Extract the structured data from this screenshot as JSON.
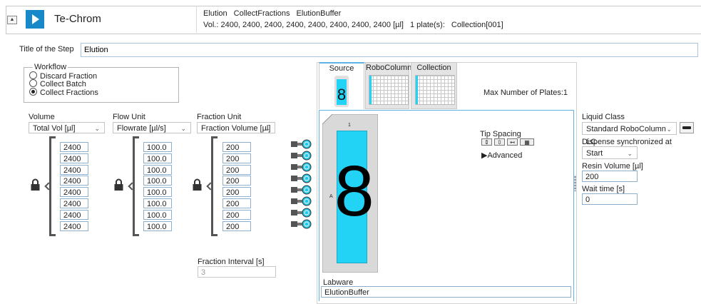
{
  "header": {
    "app_name": "Te-Chrom",
    "line1": [
      "Elution",
      "CollectFractions",
      "ElutionBuffer"
    ],
    "line2_volume": "Vol.: 2400, 2400, 2400, 2400, 2400, 2400, 2400, 2400 [µl]",
    "line2_plates": "1 plate(s):",
    "line2_collection": "Collection[001]",
    "brand_color": "#1789c8"
  },
  "step": {
    "title_label": "Title of the Step",
    "title_value": "Elution"
  },
  "workflow": {
    "legend": "Workflow",
    "options": [
      {
        "label": "Discard Fraction",
        "selected": false
      },
      {
        "label": "Collect Batch",
        "selected": false
      },
      {
        "label": "Collect Fractions",
        "selected": true
      }
    ]
  },
  "columns": {
    "volume": {
      "label": "Volume",
      "dropdown": "Total Vol [µl]",
      "values": [
        "2400",
        "2400",
        "2400",
        "2400",
        "2400",
        "2400",
        "2400",
        "2400"
      ]
    },
    "flow": {
      "label": "Flow Unit",
      "dropdown": "Flowrate [µl/s]",
      "values": [
        "100.0",
        "100.0",
        "100.0",
        "100.0",
        "100.0",
        "100.0",
        "100.0",
        "100.0"
      ]
    },
    "fraction": {
      "label": "Fraction Unit",
      "dropdown": "Fraction Volume [µl]",
      "values": [
        "200",
        "200",
        "200",
        "200",
        "200",
        "200",
        "200",
        "200"
      ]
    }
  },
  "fraction_interval": {
    "label": "Fraction Interval [s]",
    "value": "3"
  },
  "tabs": [
    {
      "label": "Source",
      "selected": true,
      "badge": "8"
    },
    {
      "label": "RoboColumn",
      "selected": false
    },
    {
      "label": "Collection",
      "selected": false
    }
  ],
  "max_plates": "Max Number of Plates:1",
  "labware_view": {
    "column_number": "1",
    "row_label": "A",
    "big_label": "8",
    "accent_color": "#22d3f5"
  },
  "tip_spacing": {
    "label": "Tip Spacing",
    "advanced": "Advanced"
  },
  "labware": {
    "label": "Labware",
    "value": "ElutionBuffer"
  },
  "right_panel": {
    "liquid_class_label": "Liquid Class",
    "liquid_class_value": "Standard RoboColumn LC",
    "dispense_label": "Dispense synchronized at",
    "dispense_value": "Start",
    "resin_label": "Resin Volume [µl]",
    "resin_value": "200",
    "wait_label": "Wait time [s]",
    "wait_value": "0"
  }
}
